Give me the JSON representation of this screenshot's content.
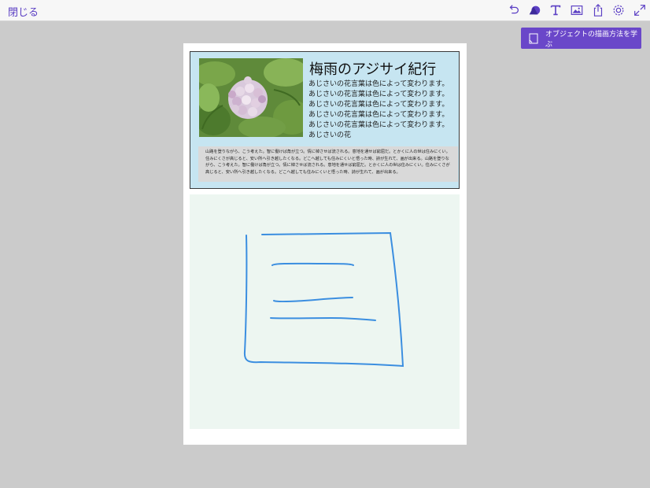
{
  "toolbar": {
    "close_label": "閉じる",
    "tools": [
      "undo-icon",
      "shapes-icon",
      "text-icon",
      "image-icon",
      "share-icon",
      "settings-icon",
      "fullscreen-icon"
    ],
    "accent_color": "#5b3fc4"
  },
  "learn_button": {
    "label": "オブジェクトの描画方法を学ぶ",
    "color": "#6a47c9"
  },
  "article": {
    "title": "梅雨のアジサイ紀行",
    "body": "あじさいの花言葉は色によって変わります。あじさいの花言葉は色によって変わります。あじさいの花言葉は色によって変わります。あじさいの花言葉は色によって変わります。あじさいの花言葉は色によって変わります。あじさいの花",
    "note": "山路を登りながら、こう考えた。智に働けば角が立つ。情に棹させば流される。意地を通せば窮屈だ。とかくに人の世は住みにくい。住みにくさが高じると、安い所へ引き越したくなる。どこへ越しても住みにくいと悟った時、詩が生れて、画が出来る。山路を登りながら、こう考えた。智に働けば角が立つ。情に棹させば流される。意地を通せば窮屈だ。とかくに人の世は住みにくい。住みにくさが高じると、安い所へ引き越したくなる。どこへ越しても住みにくいと悟った時、詩が生れて、画が出来る。",
    "header_bg": "#c6e5f1",
    "note_bg": "#d9d9d9"
  },
  "drawing": {
    "bg": "#edf6f1",
    "stroke_color": "#3b8ee0"
  }
}
